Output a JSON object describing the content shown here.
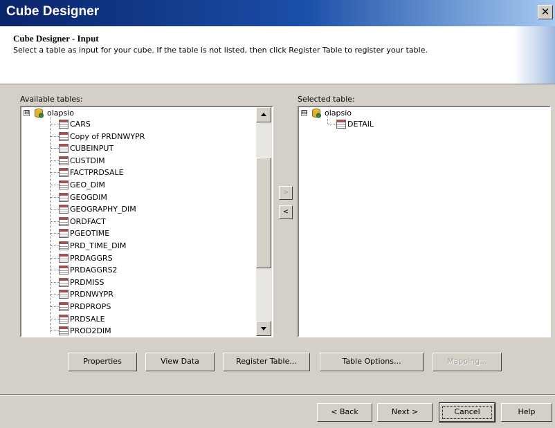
{
  "window": {
    "title": "Cube Designer",
    "close_glyph": "✕"
  },
  "header": {
    "title": "Cube Designer - Input",
    "subtitle": "Select a table as input for your cube. If the table is not listed, then click Register Table to register your table."
  },
  "available": {
    "label": "Available tables:",
    "root": "olapsio",
    "items": [
      "CARS",
      "Copy of PRDNWYPR",
      "CUBEINPUT",
      "CUSTDIM",
      "FACTPRDSALE",
      "GEO_DIM",
      "GEOGDIM",
      "GEOGRAPHY_DIM",
      "ORDFACT",
      "PGEOTIME",
      "PRD_TIME_DIM",
      "PRDAGGRS",
      "PRDAGGRS2",
      "PRDMISS",
      "PRDNWYPR",
      "PRDPROPS",
      "PRDSALE",
      "PROD2DIM"
    ]
  },
  "selected": {
    "label": "Selected table:",
    "root": "olapsio",
    "items": [
      "DETAIL"
    ]
  },
  "transfer": {
    "add_glyph": ">",
    "remove_glyph": "<"
  },
  "buttons": {
    "properties": "Properties",
    "view_data": "View Data",
    "register_table": "Register Table...",
    "table_options": "Table Options...",
    "mapping": "Mapping..."
  },
  "nav": {
    "back": "< Back",
    "next": "Next >",
    "cancel": "Cancel",
    "help": "Help"
  },
  "icons": {
    "database": "database-icon",
    "table": "table-icon",
    "expander": "⊟"
  }
}
